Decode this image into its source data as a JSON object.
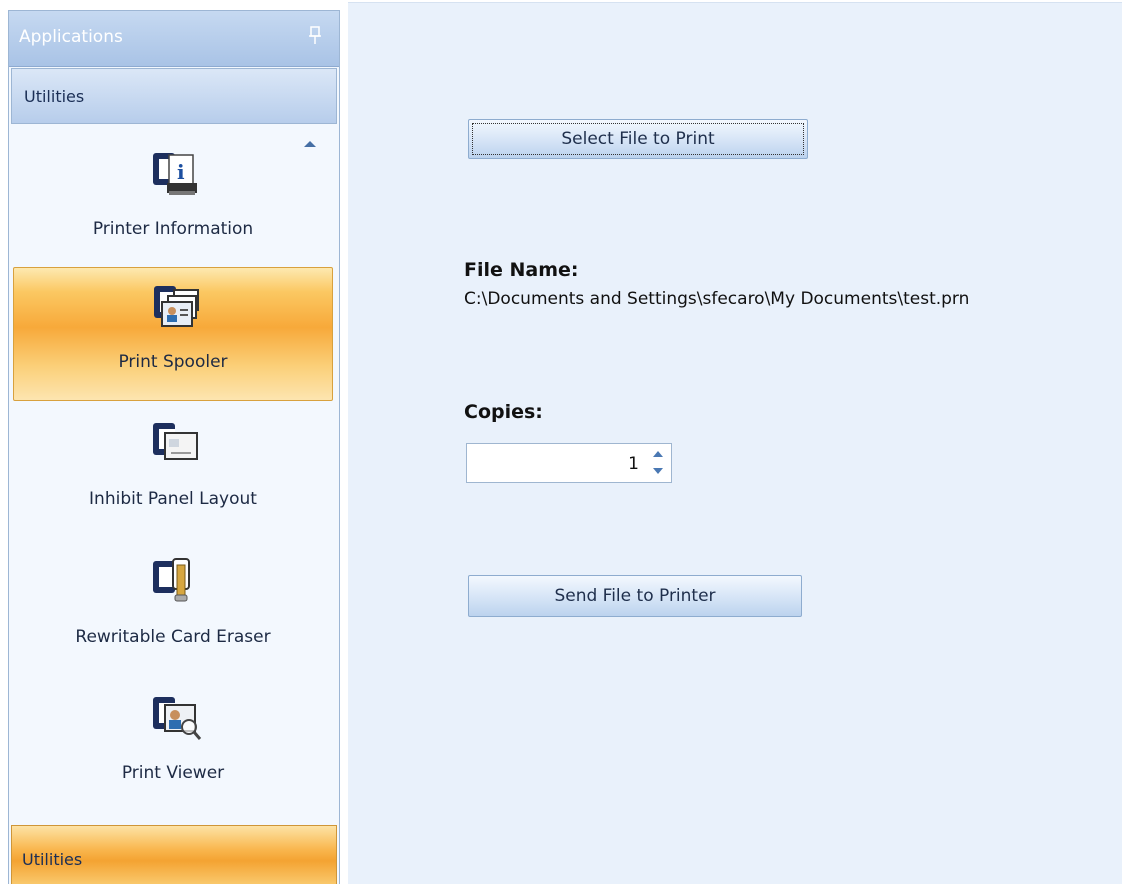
{
  "nav": {
    "title": "Applications",
    "section_top": "Utilities",
    "section_bottom": "Utilities",
    "items": [
      {
        "label": "Printer Information",
        "icon": "printer-info-icon",
        "selected": false
      },
      {
        "label": "Print Spooler",
        "icon": "print-spooler-icon",
        "selected": true
      },
      {
        "label": "Inhibit Panel Layout",
        "icon": "inhibit-panel-icon",
        "selected": false
      },
      {
        "label": "Rewritable Card Eraser",
        "icon": "card-eraser-icon",
        "selected": false
      },
      {
        "label": "Print Viewer",
        "icon": "print-viewer-icon",
        "selected": false
      }
    ]
  },
  "main": {
    "select_button": "Select File to Print",
    "file_name_label": "File Name:",
    "file_name_value": "C:\\Documents and Settings\\sfecaro\\My Documents\\test.prn",
    "copies_label": "Copies:",
    "copies_value": "1",
    "send_button": "Send File to Printer"
  },
  "colors": {
    "selected_item": "#f7a93a",
    "panel_header": "#a9c3e6",
    "content_bg": "#e9f1fb"
  }
}
